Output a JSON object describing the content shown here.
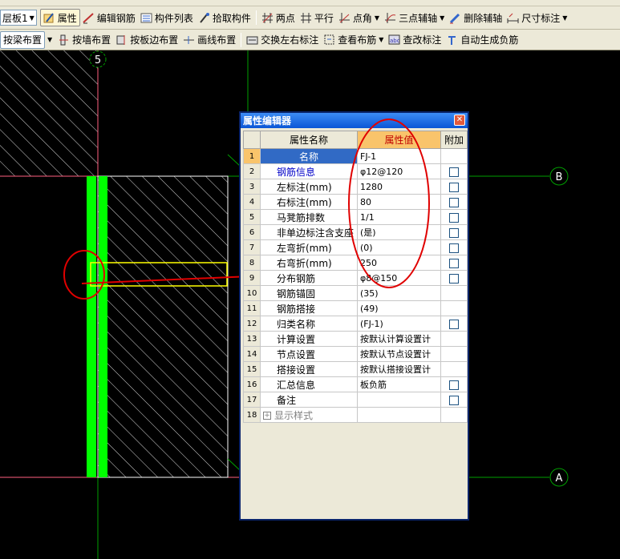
{
  "toolbar1": {
    "floor_select": "层板1",
    "items": [
      {
        "label": "属性",
        "icon": "properties-icon",
        "pressed": true
      },
      {
        "label": "编辑钢筋",
        "icon": "edit-rebar-icon"
      },
      {
        "label": "构件列表",
        "icon": "component-list-icon"
      },
      {
        "label": "拾取构件",
        "icon": "pick-component-icon"
      },
      {
        "label": "两点",
        "icon": "two-point-axis-icon"
      },
      {
        "label": "平行",
        "icon": "parallel-axis-icon"
      },
      {
        "label": "点角",
        "icon": "point-angle-axis-icon"
      },
      {
        "label": "三点辅轴",
        "icon": "three-point-axis-icon"
      },
      {
        "label": "删除辅轴",
        "icon": "delete-axis-icon"
      },
      {
        "label": "尺寸标注",
        "icon": "dimension-icon"
      }
    ]
  },
  "toolbar2": {
    "layout_select": "按梁布置",
    "items": [
      {
        "label": "按墙布置",
        "icon": "wall-layout-icon"
      },
      {
        "label": "按板边布置",
        "icon": "slab-edge-layout-icon"
      },
      {
        "label": "画线布置",
        "icon": "line-layout-icon"
      },
      {
        "label": "交换左右标注",
        "icon": "swap-annotation-icon"
      },
      {
        "label": "查看布筋",
        "icon": "view-rebar-icon"
      },
      {
        "label": "查改标注",
        "icon": "edit-annotation-icon"
      },
      {
        "label": "自动生成负筋",
        "icon": "auto-negative-rebar-icon"
      }
    ]
  },
  "canvas": {
    "axis_labels": {
      "top": "5",
      "b": "B",
      "a": "A"
    },
    "colors": {
      "background": "#000000",
      "axis": "#00a000",
      "slab_edge": "#ff6080",
      "rebar": "#00ff00",
      "hatch": "#e0e0e0",
      "highlight": "#ffff00",
      "annotation": "#e00000"
    }
  },
  "dialog": {
    "title": "属性编辑器",
    "headers": {
      "name": "属性名称",
      "value": "属性值",
      "extra": "附加"
    },
    "rows": [
      {
        "num": "1",
        "name": "名称",
        "value": "FJ-1",
        "check": false,
        "selected": true,
        "blue": false
      },
      {
        "num": "2",
        "name": "钢筋信息",
        "value": "φ12@120",
        "check": true,
        "blue": true
      },
      {
        "num": "3",
        "name": "左标注(mm)",
        "value": "1280",
        "check": true
      },
      {
        "num": "4",
        "name": "右标注(mm)",
        "value": "80",
        "check": true
      },
      {
        "num": "5",
        "name": "马凳筋排数",
        "value": "1/1",
        "check": true
      },
      {
        "num": "6",
        "name": "非单边标注含支座",
        "value": "(是)",
        "check": true
      },
      {
        "num": "7",
        "name": "左弯折(mm)",
        "value": "(0)",
        "check": true
      },
      {
        "num": "8",
        "name": "右弯折(mm)",
        "value": "250",
        "check": true
      },
      {
        "num": "9",
        "name": "分布钢筋",
        "value": "φ8@150",
        "check": true
      },
      {
        "num": "10",
        "name": "钢筋锚固",
        "value": "(35)",
        "check": false
      },
      {
        "num": "11",
        "name": "钢筋搭接",
        "value": "(49)",
        "check": false
      },
      {
        "num": "12",
        "name": "归类名称",
        "value": "(FJ-1)",
        "check": true
      },
      {
        "num": "13",
        "name": "计算设置",
        "value": "按默认计算设置计",
        "check": false
      },
      {
        "num": "14",
        "name": "节点设置",
        "value": "按默认节点设置计",
        "check": false
      },
      {
        "num": "15",
        "name": "搭接设置",
        "value": "按默认搭接设置计",
        "check": false
      },
      {
        "num": "16",
        "name": "汇总信息",
        "value": "板负筋",
        "check": true
      },
      {
        "num": "17",
        "name": "备注",
        "value": "",
        "check": true
      },
      {
        "num": "18",
        "name": "显示样式",
        "value": "",
        "check": false,
        "group": true
      }
    ]
  }
}
